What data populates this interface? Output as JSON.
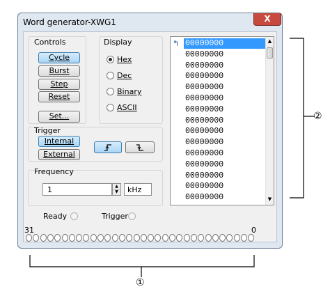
{
  "window": {
    "title": "Word generator-XWG1",
    "close_label": "X"
  },
  "controls": {
    "heading": "Controls",
    "cycle": "Cycle",
    "burst": "Burst",
    "step": "Step",
    "reset": "Reset",
    "set": "Set..."
  },
  "display": {
    "heading": "Display",
    "options": [
      "Hex",
      "Dec",
      "Binary",
      "ASCII"
    ],
    "selected": "Hex"
  },
  "trigger": {
    "heading": "Trigger",
    "internal": "Internal",
    "external": "External",
    "rising_icon": "rising-edge-icon",
    "falling_icon": "falling-edge-icon"
  },
  "frequency": {
    "heading": "Frequency",
    "value": "1",
    "unit": "kHz"
  },
  "status": {
    "ready": "Ready",
    "trigger": "Trigger"
  },
  "bits": {
    "msb": "31",
    "lsb": "0",
    "count": 32
  },
  "word_list": {
    "cursor_icon": "cursor-arrow-icon",
    "rows": [
      "00000000",
      "00000000",
      "00000000",
      "00000000",
      "00000000",
      "00000000",
      "00000000",
      "00000000",
      "00000000",
      "00000000",
      "00000000",
      "00000000",
      "00000000",
      "00000000",
      "00000000"
    ]
  },
  "annotations": {
    "marker_1": "①",
    "marker_2": "②"
  }
}
